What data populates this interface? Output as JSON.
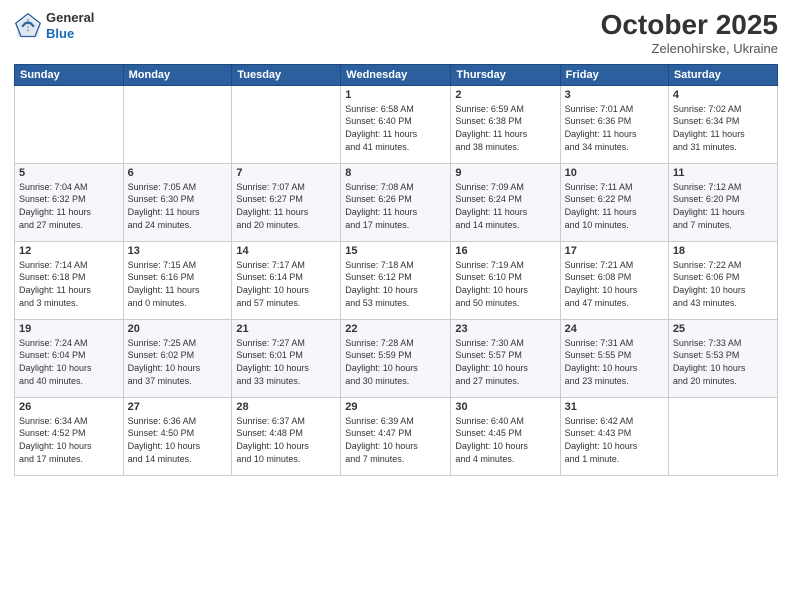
{
  "header": {
    "logo_general": "General",
    "logo_blue": "Blue",
    "month": "October 2025",
    "location": "Zelenohirske, Ukraine"
  },
  "weekdays": [
    "Sunday",
    "Monday",
    "Tuesday",
    "Wednesday",
    "Thursday",
    "Friday",
    "Saturday"
  ],
  "weeks": [
    [
      {
        "day": "",
        "info": ""
      },
      {
        "day": "",
        "info": ""
      },
      {
        "day": "",
        "info": ""
      },
      {
        "day": "1",
        "info": "Sunrise: 6:58 AM\nSunset: 6:40 PM\nDaylight: 11 hours\nand 41 minutes."
      },
      {
        "day": "2",
        "info": "Sunrise: 6:59 AM\nSunset: 6:38 PM\nDaylight: 11 hours\nand 38 minutes."
      },
      {
        "day": "3",
        "info": "Sunrise: 7:01 AM\nSunset: 6:36 PM\nDaylight: 11 hours\nand 34 minutes."
      },
      {
        "day": "4",
        "info": "Sunrise: 7:02 AM\nSunset: 6:34 PM\nDaylight: 11 hours\nand 31 minutes."
      }
    ],
    [
      {
        "day": "5",
        "info": "Sunrise: 7:04 AM\nSunset: 6:32 PM\nDaylight: 11 hours\nand 27 minutes."
      },
      {
        "day": "6",
        "info": "Sunrise: 7:05 AM\nSunset: 6:30 PM\nDaylight: 11 hours\nand 24 minutes."
      },
      {
        "day": "7",
        "info": "Sunrise: 7:07 AM\nSunset: 6:27 PM\nDaylight: 11 hours\nand 20 minutes."
      },
      {
        "day": "8",
        "info": "Sunrise: 7:08 AM\nSunset: 6:26 PM\nDaylight: 11 hours\nand 17 minutes."
      },
      {
        "day": "9",
        "info": "Sunrise: 7:09 AM\nSunset: 6:24 PM\nDaylight: 11 hours\nand 14 minutes."
      },
      {
        "day": "10",
        "info": "Sunrise: 7:11 AM\nSunset: 6:22 PM\nDaylight: 11 hours\nand 10 minutes."
      },
      {
        "day": "11",
        "info": "Sunrise: 7:12 AM\nSunset: 6:20 PM\nDaylight: 11 hours\nand 7 minutes."
      }
    ],
    [
      {
        "day": "12",
        "info": "Sunrise: 7:14 AM\nSunset: 6:18 PM\nDaylight: 11 hours\nand 3 minutes."
      },
      {
        "day": "13",
        "info": "Sunrise: 7:15 AM\nSunset: 6:16 PM\nDaylight: 11 hours\nand 0 minutes."
      },
      {
        "day": "14",
        "info": "Sunrise: 7:17 AM\nSunset: 6:14 PM\nDaylight: 10 hours\nand 57 minutes."
      },
      {
        "day": "15",
        "info": "Sunrise: 7:18 AM\nSunset: 6:12 PM\nDaylight: 10 hours\nand 53 minutes."
      },
      {
        "day": "16",
        "info": "Sunrise: 7:19 AM\nSunset: 6:10 PM\nDaylight: 10 hours\nand 50 minutes."
      },
      {
        "day": "17",
        "info": "Sunrise: 7:21 AM\nSunset: 6:08 PM\nDaylight: 10 hours\nand 47 minutes."
      },
      {
        "day": "18",
        "info": "Sunrise: 7:22 AM\nSunset: 6:06 PM\nDaylight: 10 hours\nand 43 minutes."
      }
    ],
    [
      {
        "day": "19",
        "info": "Sunrise: 7:24 AM\nSunset: 6:04 PM\nDaylight: 10 hours\nand 40 minutes."
      },
      {
        "day": "20",
        "info": "Sunrise: 7:25 AM\nSunset: 6:02 PM\nDaylight: 10 hours\nand 37 minutes."
      },
      {
        "day": "21",
        "info": "Sunrise: 7:27 AM\nSunset: 6:01 PM\nDaylight: 10 hours\nand 33 minutes."
      },
      {
        "day": "22",
        "info": "Sunrise: 7:28 AM\nSunset: 5:59 PM\nDaylight: 10 hours\nand 30 minutes."
      },
      {
        "day": "23",
        "info": "Sunrise: 7:30 AM\nSunset: 5:57 PM\nDaylight: 10 hours\nand 27 minutes."
      },
      {
        "day": "24",
        "info": "Sunrise: 7:31 AM\nSunset: 5:55 PM\nDaylight: 10 hours\nand 23 minutes."
      },
      {
        "day": "25",
        "info": "Sunrise: 7:33 AM\nSunset: 5:53 PM\nDaylight: 10 hours\nand 20 minutes."
      }
    ],
    [
      {
        "day": "26",
        "info": "Sunrise: 6:34 AM\nSunset: 4:52 PM\nDaylight: 10 hours\nand 17 minutes."
      },
      {
        "day": "27",
        "info": "Sunrise: 6:36 AM\nSunset: 4:50 PM\nDaylight: 10 hours\nand 14 minutes."
      },
      {
        "day": "28",
        "info": "Sunrise: 6:37 AM\nSunset: 4:48 PM\nDaylight: 10 hours\nand 10 minutes."
      },
      {
        "day": "29",
        "info": "Sunrise: 6:39 AM\nSunset: 4:47 PM\nDaylight: 10 hours\nand 7 minutes."
      },
      {
        "day": "30",
        "info": "Sunrise: 6:40 AM\nSunset: 4:45 PM\nDaylight: 10 hours\nand 4 minutes."
      },
      {
        "day": "31",
        "info": "Sunrise: 6:42 AM\nSunset: 4:43 PM\nDaylight: 10 hours\nand 1 minute."
      },
      {
        "day": "",
        "info": ""
      }
    ]
  ]
}
